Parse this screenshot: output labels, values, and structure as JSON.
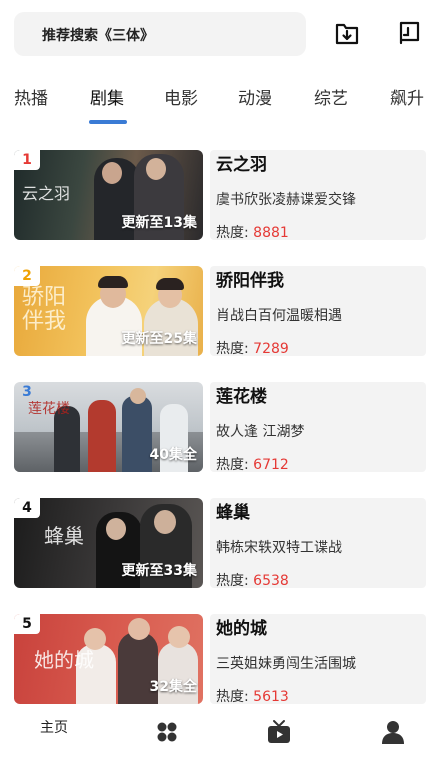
{
  "search": {
    "text": "推荐搜索《三体》"
  },
  "header": {
    "download_icon": "download-icon",
    "history_icon": "history-icon"
  },
  "tabs": [
    {
      "label": "热播"
    },
    {
      "label": "剧集",
      "active": true
    },
    {
      "label": "电影"
    },
    {
      "label": "动漫"
    },
    {
      "label": "综艺"
    },
    {
      "label": "飙升"
    }
  ],
  "heat_label": "热度: ",
  "list": [
    {
      "rank": "1",
      "rank_color": "#e53935",
      "title": "云之羽",
      "thumb_text": "云之羽",
      "progress": "更新至13集",
      "desc": "虞书欣张凌赫谍爱交锋",
      "heat": "8881"
    },
    {
      "rank": "2",
      "rank_color": "#f0a202",
      "title": "骄阳伴我",
      "thumb_text": "骄阳伴我",
      "progress": "更新至25集",
      "desc": "肖战白百何温暖相遇",
      "heat": "7289"
    },
    {
      "rank": "3",
      "rank_color": "#3a7bd5",
      "title": "莲花楼",
      "thumb_text": "莲花楼",
      "progress": "40集全",
      "desc": "故人逢 江湖梦",
      "heat": "6712"
    },
    {
      "rank": "4",
      "rank_color": "#111111",
      "title": "蜂巢",
      "thumb_text": "蜂巢",
      "progress": "更新至33集",
      "desc": "韩栋宋轶双特工谍战",
      "heat": "6538"
    },
    {
      "rank": "5",
      "rank_color": "#111111",
      "title": "她的城",
      "thumb_text": "她的城",
      "progress": "32集全",
      "desc": "三英姐妹勇闯生活围城",
      "heat": "5613"
    }
  ],
  "bottom_nav": [
    {
      "label": "主页",
      "icon": "home"
    },
    {
      "label": "",
      "icon": "grid-icon"
    },
    {
      "label": "",
      "icon": "tv-icon"
    },
    {
      "label": "",
      "icon": "user-icon"
    }
  ]
}
